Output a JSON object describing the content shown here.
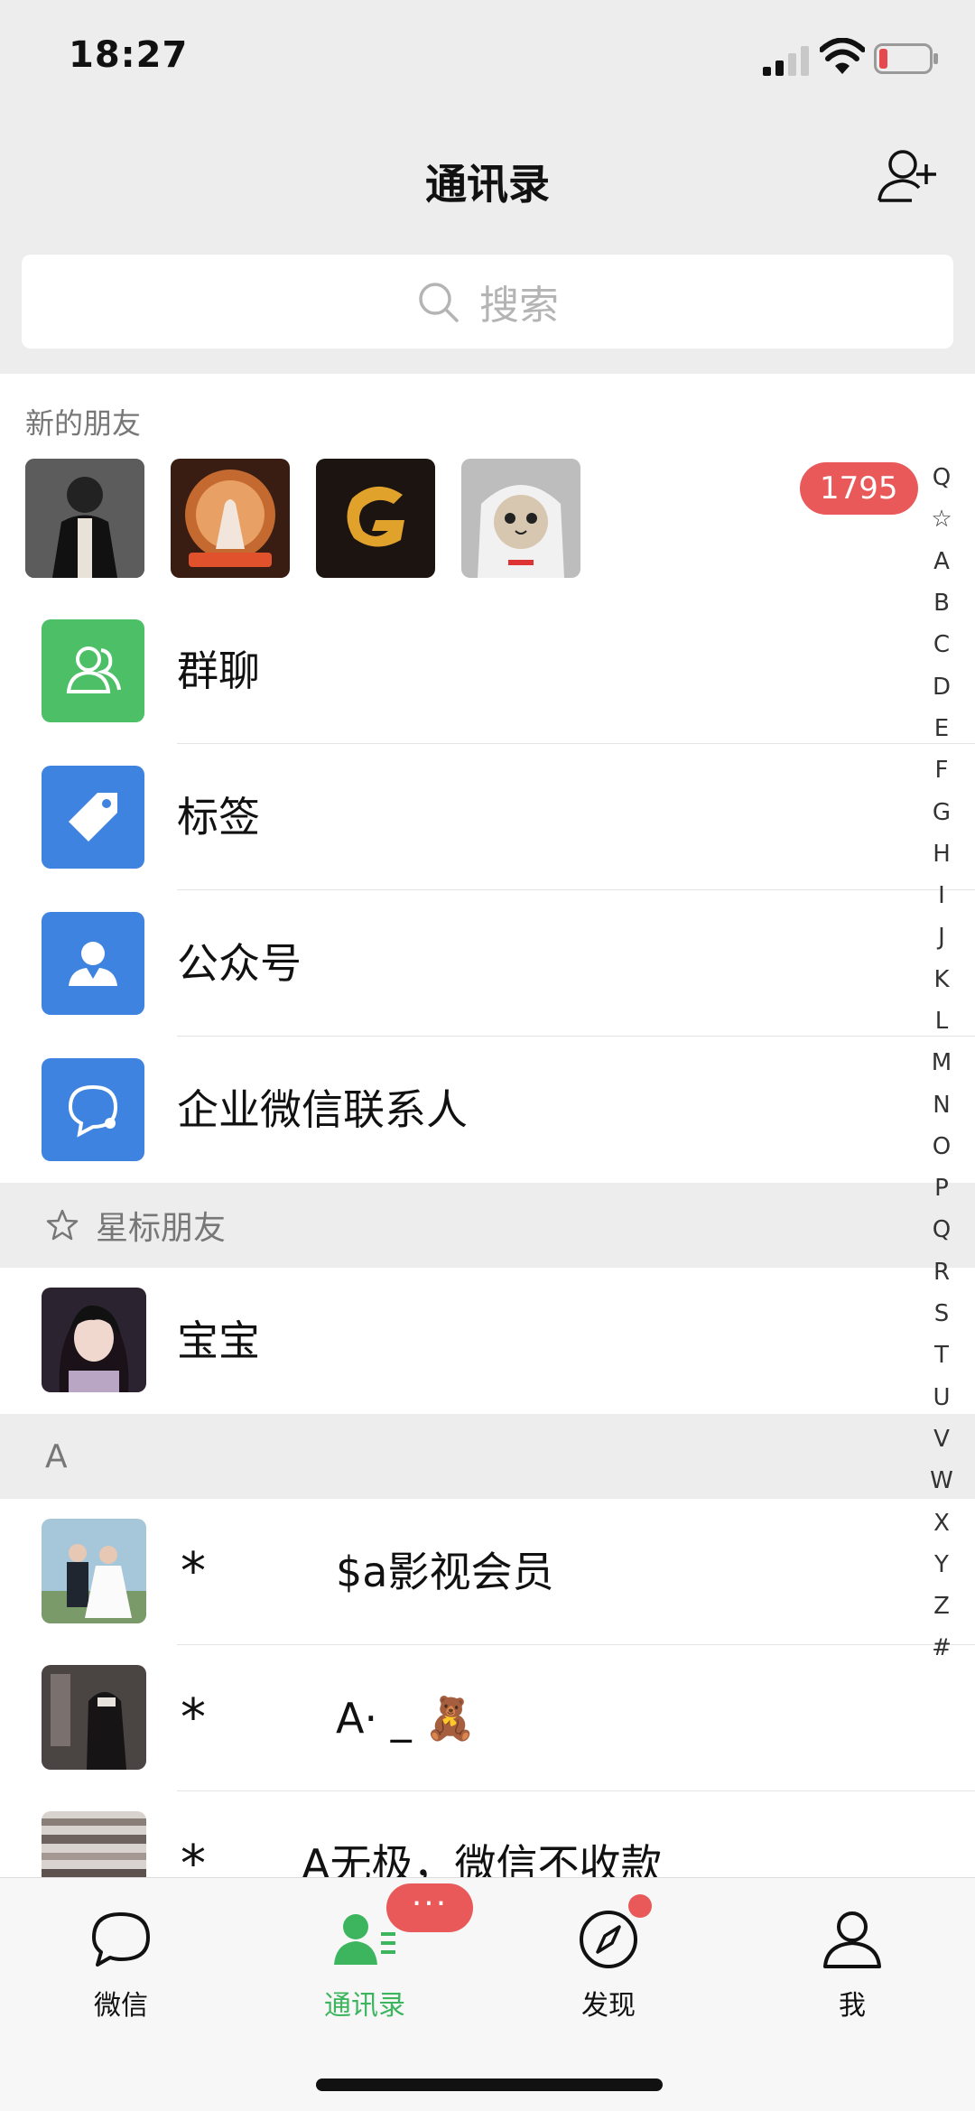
{
  "status": {
    "time": "18:27"
  },
  "header": {
    "title": "通讯录"
  },
  "search": {
    "placeholder": "搜索"
  },
  "new_friends": {
    "label": "新的朋友",
    "count": "1795"
  },
  "menu": [
    {
      "label": "群聊",
      "icon": "group-chat-icon",
      "color": "#4cbf67"
    },
    {
      "label": "标签",
      "icon": "tag-icon",
      "color": "#3f83e0"
    },
    {
      "label": "公众号",
      "icon": "official-account-icon",
      "color": "#3f83e0"
    },
    {
      "label": "企业微信联系人",
      "icon": "enterprise-wechat-icon",
      "color": "#3f83e0"
    }
  ],
  "starred": {
    "header": "星标朋友",
    "contacts": [
      {
        "star": "",
        "name": "宝宝"
      }
    ]
  },
  "section_a": {
    "header": "A",
    "contacts": [
      {
        "star": "*",
        "name": "$a影视会员"
      },
      {
        "star": "*",
        "name": "A· _ 🧸"
      },
      {
        "star": "*",
        "name": "A无极，微信不收款"
      }
    ]
  },
  "index": [
    "Q",
    "☆",
    "A",
    "B",
    "C",
    "D",
    "E",
    "F",
    "G",
    "H",
    "I",
    "J",
    "K",
    "L",
    "M",
    "N",
    "O",
    "P",
    "Q",
    "R",
    "S",
    "T",
    "U",
    "V",
    "W",
    "X",
    "Y",
    "Z",
    "#"
  ],
  "tabs": [
    {
      "label": "微信",
      "icon": "chat-bubble-icon"
    },
    {
      "label": "通讯录",
      "icon": "contacts-icon",
      "active": true,
      "badge": "···"
    },
    {
      "label": "发现",
      "icon": "compass-icon"
    },
    {
      "label": "我",
      "icon": "person-icon"
    }
  ],
  "colors": {
    "accent": "#3db55e",
    "badge": "#e9595a",
    "blue_icon": "#3f83e0",
    "green_icon": "#4cbf67"
  }
}
